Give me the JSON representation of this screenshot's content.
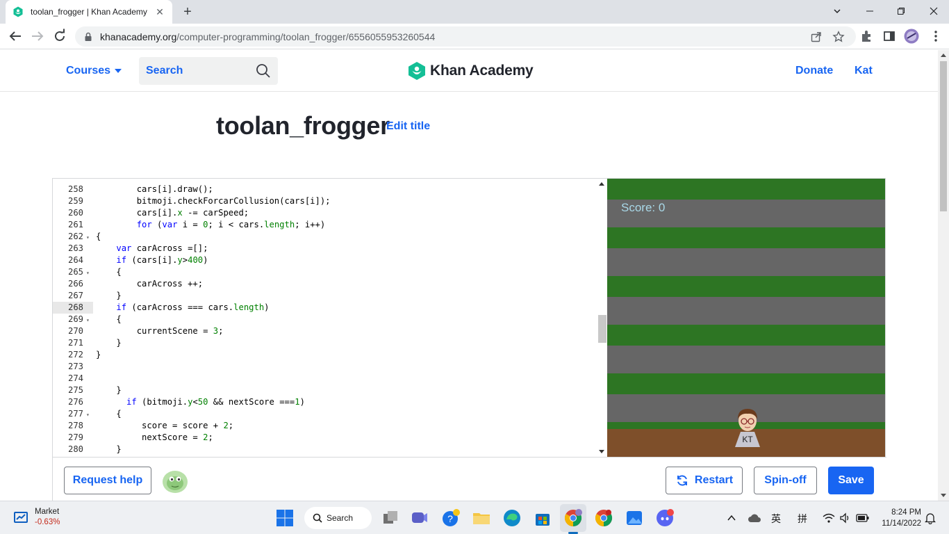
{
  "browser": {
    "tab_title": "toolan_frogger | Khan Academy",
    "url_host": "khanacademy.org",
    "url_path": "/computer-programming/toolan_frogger/6556055953260544",
    "new_tab_label": "+",
    "tab_close_label": "✕"
  },
  "header": {
    "courses_label": "Courses",
    "search_placeholder": "Search",
    "logo_text": "Khan Academy",
    "donate_label": "Donate",
    "user_label": "Kat"
  },
  "program": {
    "title": "toolan_frogger",
    "edit_title_label": "Edit title"
  },
  "editor": {
    "lines": [
      {
        "n": "258",
        "fold": "",
        "code": "        cars[i].draw();"
      },
      {
        "n": "259",
        "fold": "",
        "code": "        bitmoji.checkForcarCollusion(cars[i]);"
      },
      {
        "n": "260",
        "fold": "",
        "code": "        cars[i].x -= carSpeed;"
      },
      {
        "n": "261",
        "fold": "",
        "code": "        for (var i = 0; i < cars.length; i++)"
      },
      {
        "n": "262",
        "fold": "▾",
        "code": "{"
      },
      {
        "n": "263",
        "fold": "",
        "code": "    var carAcross =[];"
      },
      {
        "n": "264",
        "fold": "",
        "code": "    if (cars[i].y>400)"
      },
      {
        "n": "265",
        "fold": "▾",
        "code": "    {"
      },
      {
        "n": "266",
        "fold": "",
        "code": "        carAcross ++;"
      },
      {
        "n": "267",
        "fold": "",
        "code": "    }"
      },
      {
        "n": "268",
        "fold": "",
        "code": "    if (carAcross === cars.length)"
      },
      {
        "n": "269",
        "fold": "▾",
        "code": "    {"
      },
      {
        "n": "270",
        "fold": "",
        "code": "        currentScene = 3;"
      },
      {
        "n": "271",
        "fold": "",
        "code": "    }"
      },
      {
        "n": "272",
        "fold": "",
        "code": "}"
      },
      {
        "n": "273",
        "fold": "",
        "code": ""
      },
      {
        "n": "274",
        "fold": "",
        "code": ""
      },
      {
        "n": "275",
        "fold": "",
        "code": "    }"
      },
      {
        "n": "276",
        "fold": "",
        "code": "      if (bitmoji.y<50 && nextScore ===1)"
      },
      {
        "n": "277",
        "fold": "▾",
        "code": "    {"
      },
      {
        "n": "278",
        "fold": "",
        "code": "         score = score + 2;"
      },
      {
        "n": "279",
        "fold": "",
        "code": "         nextScore = 2;"
      },
      {
        "n": "280",
        "fold": "",
        "code": "    }"
      }
    ],
    "active_line": "268"
  },
  "game": {
    "score_text": "Score: 0",
    "avatar_initials": "KT",
    "colors": {
      "grass": "#2d7523",
      "road": "#666666",
      "dirt": "#7e4f2a",
      "score": "#a9d8e8"
    }
  },
  "footer": {
    "request_help_label": "Request help",
    "restart_label": "Restart",
    "spinoff_label": "Spin-off",
    "save_label": "Save"
  },
  "taskbar": {
    "market_label": "Market",
    "market_change": "-0.63%",
    "search_label": "Search",
    "ime_label_1": "英",
    "ime_label_2": "拼",
    "time": "8:24 PM",
    "date": "11/14/2022"
  },
  "accent": "#1865f2"
}
